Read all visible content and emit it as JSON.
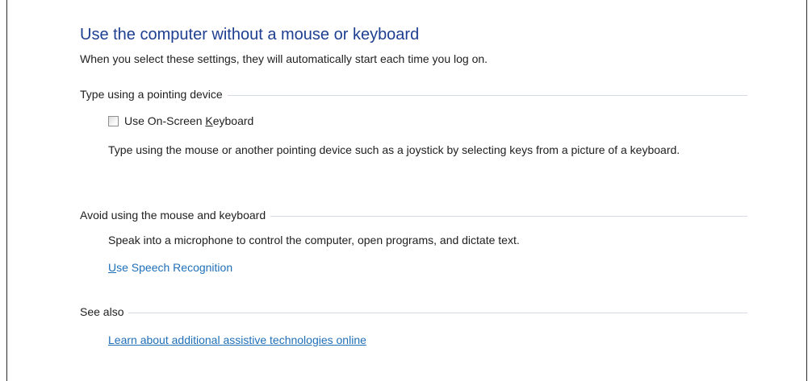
{
  "header": {
    "title": "Use the computer without a mouse or keyboard",
    "subtitle": "When you select these settings, they will automatically start each time you log on."
  },
  "sections": {
    "pointing": {
      "heading": "Type using a pointing device",
      "checkbox": {
        "label_pre": "Use On-Screen ",
        "label_accel": "K",
        "label_post": "eyboard",
        "checked": false
      },
      "description": "Type using the mouse or another pointing device such as a joystick by selecting keys from a picture of a keyboard."
    },
    "avoid": {
      "heading": "Avoid using the mouse and keyboard",
      "description": "Speak into a microphone to control the computer, open programs, and dictate text.",
      "link": {
        "accel": "U",
        "rest": "se Speech Recognition"
      }
    },
    "see_also": {
      "heading": "See also",
      "link": "Learn about additional assistive technologies online"
    }
  },
  "colors": {
    "title": "#1e3f91",
    "link": "#1f6fb8",
    "rule": "#d6dbe3"
  }
}
